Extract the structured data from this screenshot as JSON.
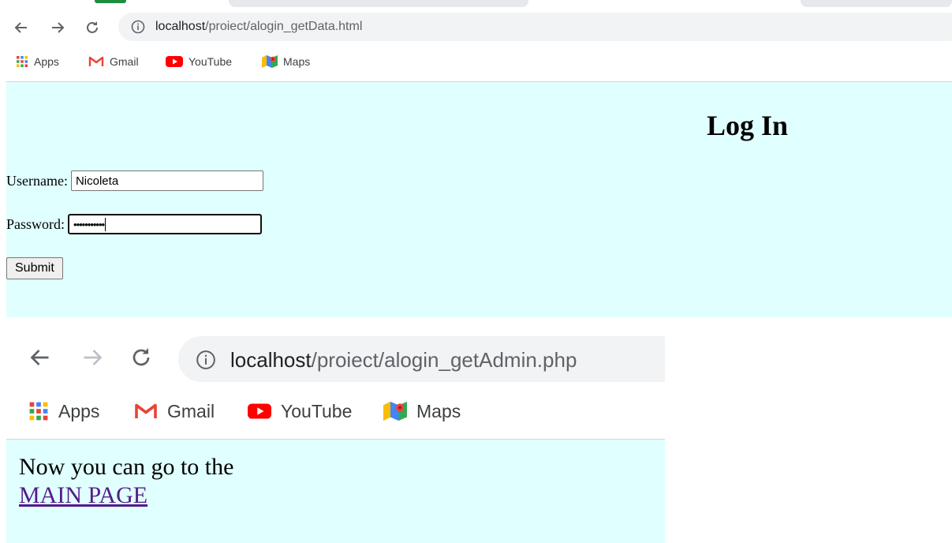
{
  "top_browser": {
    "url_host": "localhost",
    "url_path": "/proiect/alogin_getData.html",
    "bookmarks": [
      {
        "label": "Apps",
        "icon": "apps-grid-icon"
      },
      {
        "label": "Gmail",
        "icon": "gmail-icon"
      },
      {
        "label": "YouTube",
        "icon": "youtube-icon"
      },
      {
        "label": "Maps",
        "icon": "maps-icon"
      }
    ]
  },
  "login_page": {
    "title": "Log In",
    "username_label": "Username:",
    "username_value": "Nicoleta",
    "password_label": "Password:",
    "password_masked": "•••••••••••",
    "submit_label": "Submit",
    "background": "#e0ffff"
  },
  "bottom_browser": {
    "url_host": "localhost",
    "url_path": "/proiect/alogin_getAdmin.php",
    "bookmarks": [
      {
        "label": "Apps",
        "icon": "apps-grid-icon"
      },
      {
        "label": "Gmail",
        "icon": "gmail-icon"
      },
      {
        "label": "YouTube",
        "icon": "youtube-icon"
      },
      {
        "label": "Maps",
        "icon": "maps-icon"
      }
    ]
  },
  "admin_page": {
    "message": "Now you can go to the",
    "link_label": "MAIN PAGE",
    "link_color": "#551a8b"
  }
}
